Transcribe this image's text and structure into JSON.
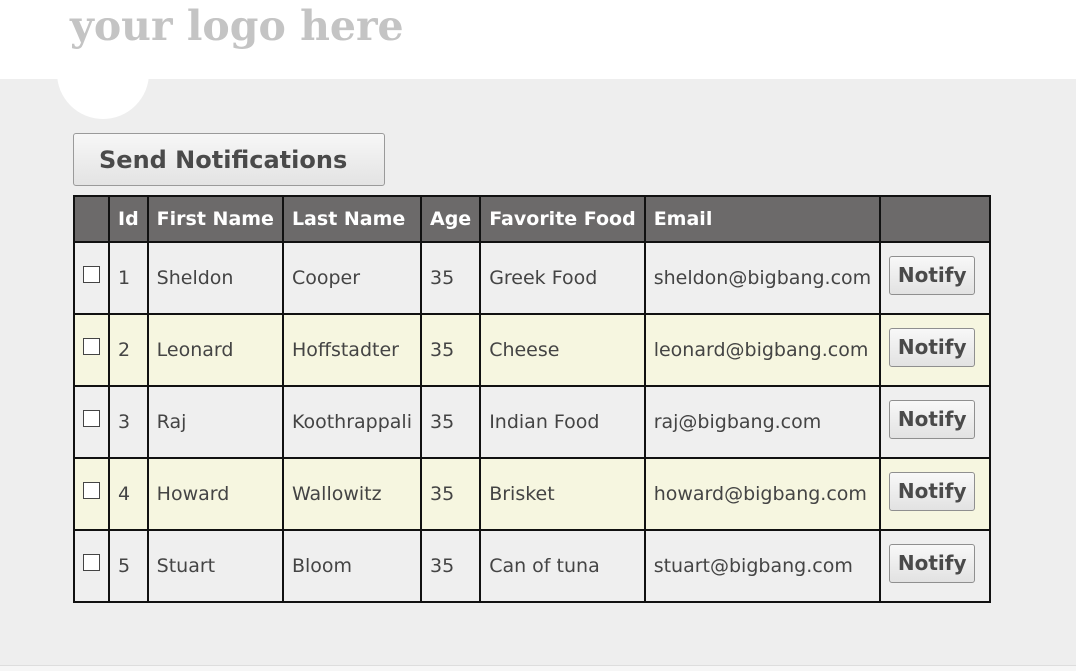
{
  "header": {
    "logo_text": "your logo here"
  },
  "toolbar": {
    "send_label": "Send Notifications"
  },
  "table": {
    "headers": {
      "check": "",
      "id": "Id",
      "first": "First Name",
      "last": "Last Name",
      "age": "Age",
      "food": "Favorite Food",
      "email": "Email",
      "action": ""
    },
    "rows": [
      {
        "id": "1",
        "first": "Sheldon",
        "last": "Cooper",
        "age": "35",
        "food": "Greek Food",
        "email": "sheldon@bigbang.com",
        "checked": false,
        "action_label": "Notify"
      },
      {
        "id": "2",
        "first": "Leonard",
        "last": "Hoffstadter",
        "age": "35",
        "food": "Cheese",
        "email": "leonard@bigbang.com",
        "checked": false,
        "action_label": "Notify"
      },
      {
        "id": "3",
        "first": "Raj",
        "last": "Koothrappali",
        "age": "35",
        "food": "Indian Food",
        "email": "raj@bigbang.com",
        "checked": false,
        "action_label": "Notify"
      },
      {
        "id": "4",
        "first": "Howard",
        "last": "Wallowitz",
        "age": "35",
        "food": "Brisket",
        "email": "howard@bigbang.com",
        "checked": false,
        "action_label": "Notify"
      },
      {
        "id": "5",
        "first": "Stuart",
        "last": "Bloom",
        "age": "35",
        "food": "Can of tuna",
        "email": "stuart@bigbang.com",
        "checked": false,
        "action_label": "Notify"
      }
    ]
  },
  "colors": {
    "header_bg": "#6c6a6a",
    "row_odd": "#efefef",
    "row_even": "#f6f6e0",
    "page_bg": "#eeeeee",
    "logo": "#c4c4c4"
  }
}
